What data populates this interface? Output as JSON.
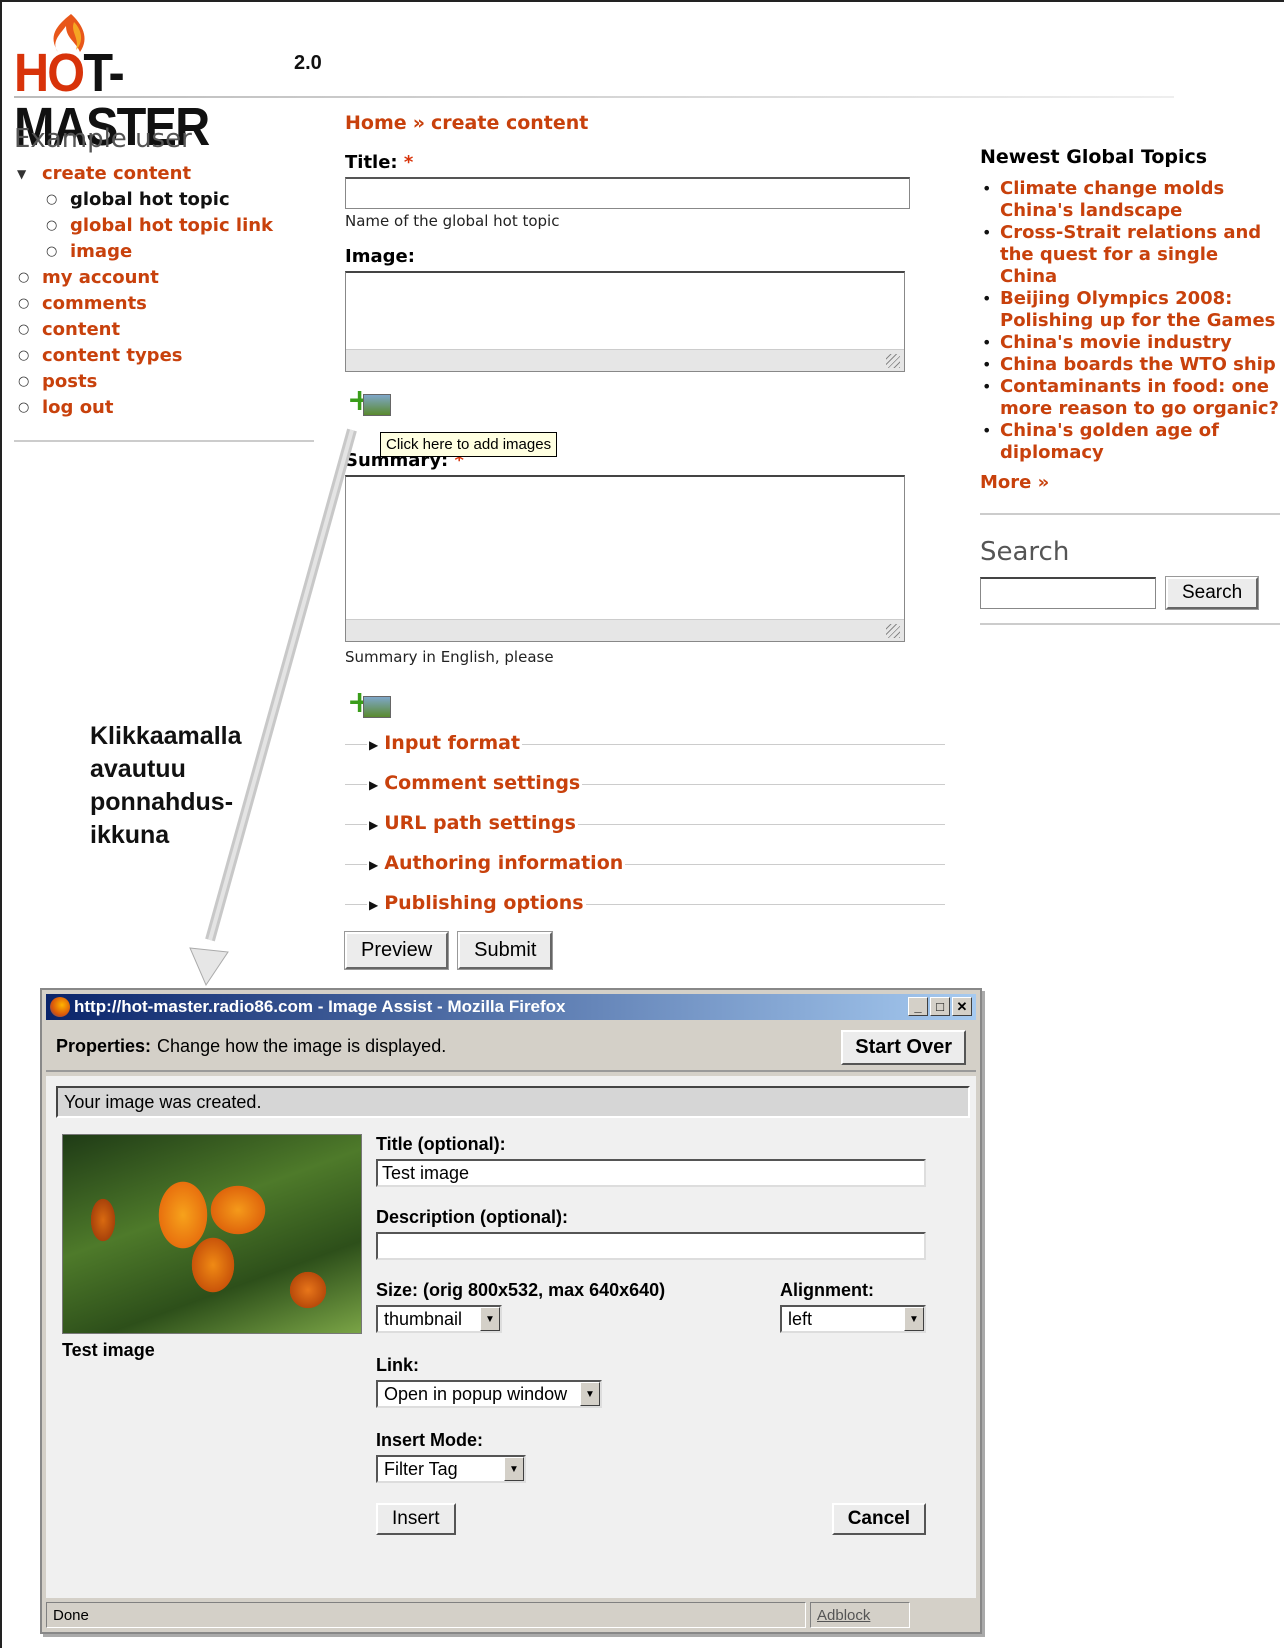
{
  "logo": {
    "brand_hot": "H",
    "brand_o": "O",
    "brand_rest": "T-MASTER",
    "version": "2.0"
  },
  "sidebar": {
    "title": "Example user",
    "create_content": "create content",
    "sub_items": [
      "global hot topic",
      "global hot topic link",
      "image"
    ],
    "items": [
      "my account",
      "comments",
      "content",
      "content types",
      "posts",
      "log out"
    ]
  },
  "breadcrumb": {
    "home": "Home",
    "sep": "»",
    "current": "create content"
  },
  "form": {
    "title_label": "Title:",
    "title_desc": "Name of the global hot topic",
    "image_label": "Image:",
    "tooltip": "Click here to add images",
    "summary_label": "Summary:",
    "summary_desc": "Summary in English, please",
    "required_mark": "*",
    "fieldsets": [
      "Input format",
      "Comment settings",
      "URL path settings",
      "Authoring information",
      "Publishing options"
    ],
    "preview_btn": "Preview",
    "submit_btn": "Submit"
  },
  "right": {
    "topics_title": "Newest Global Topics",
    "topics": [
      "Climate change molds China's landscape",
      "Cross-Strait relations and the quest for a single China",
      "Beijing Olympics 2008: Polishing up for the Games",
      "China's movie industry",
      "China boards the WTO ship",
      "Contaminants in food: one more reason to go organic?",
      "China's golden age of diplomacy"
    ],
    "more": "More »",
    "search_title": "Search",
    "search_btn": "Search"
  },
  "annotation": {
    "lines": [
      "Klikkaamalla",
      "avautuu",
      "ponnahdus-",
      "ikkuna"
    ]
  },
  "popup": {
    "window_title": "http://hot-master.radio86.com - Image Assist - Mozilla Firefox",
    "props_label": "Properties:",
    "props_text": "Change how the image is displayed.",
    "start_over": "Start Over",
    "message": "Your image was created.",
    "image_caption": "Test image",
    "title_label": "Title (optional):",
    "title_value": "Test image",
    "desc_label": "Description (optional):",
    "desc_value": "",
    "size_label": "Size: (orig 800x532, max 640x640)",
    "size_value": "thumbnail",
    "align_label": "Alignment:",
    "align_value": "left",
    "link_label": "Link:",
    "link_value": "Open in popup window",
    "insert_mode_label": "Insert Mode:",
    "insert_mode_value": "Filter Tag",
    "insert_btn": "Insert",
    "cancel_btn": "Cancel",
    "status": "Done",
    "adblock": "Adblock"
  }
}
